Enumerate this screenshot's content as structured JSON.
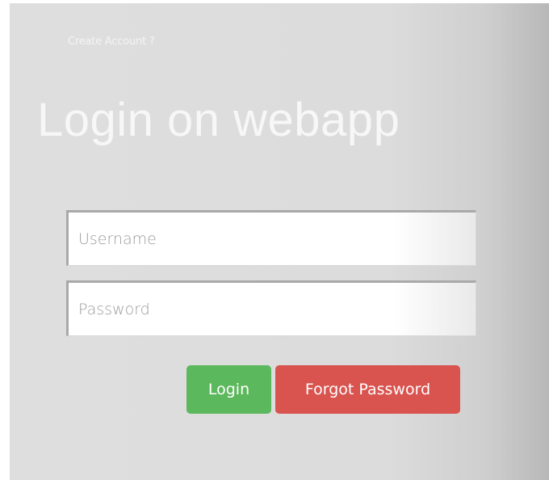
{
  "links": {
    "create_account": "Create Account ?"
  },
  "heading": {
    "title": "Login on webapp"
  },
  "form": {
    "username_placeholder": "Username",
    "username_value": "",
    "password_placeholder": "Password",
    "password_value": "",
    "login_label": "Login",
    "forgot_label": "Forgot Password"
  },
  "colors": {
    "panel_background": "#dcdcdc",
    "title_text": "#f7f7f7",
    "login_button": "#5cb85c",
    "forgot_button": "#d9534f"
  }
}
